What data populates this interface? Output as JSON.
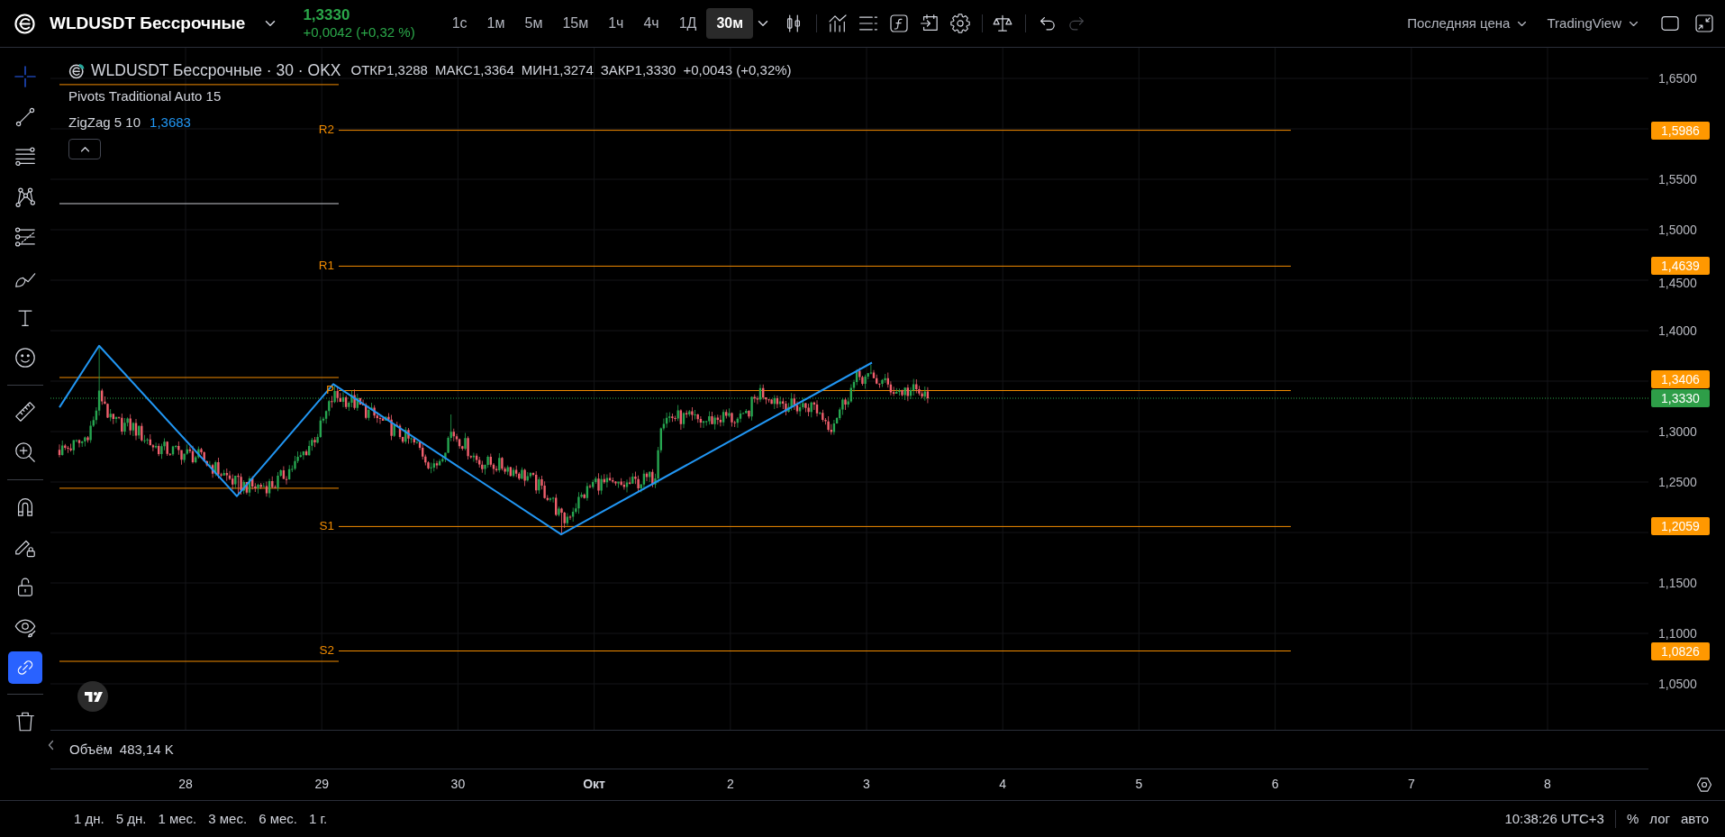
{
  "header": {
    "symbol": "WLDUSDT Бессрочные",
    "price": "1,3330",
    "change": "+0,0042 (+0,32 %)"
  },
  "intervals": [
    {
      "label": "1с",
      "selected": false
    },
    {
      "label": "1м",
      "selected": false
    },
    {
      "label": "5м",
      "selected": false
    },
    {
      "label": "15м",
      "selected": false
    },
    {
      "label": "1ч",
      "selected": false
    },
    {
      "label": "4ч",
      "selected": false
    },
    {
      "label": "1Д",
      "selected": false
    },
    {
      "label": "30м",
      "selected": true
    }
  ],
  "history": [
    {
      "disabled": false
    },
    {
      "disabled": true
    }
  ],
  "menus": {
    "price_source": "Последняя цена",
    "layout": "TradingView"
  },
  "tools": {
    "drawing": [
      {
        "selected": true
      },
      {
        "selected": false
      },
      {
        "selected": false
      },
      {
        "selected": false
      },
      {
        "selected": false
      },
      {
        "selected": false
      },
      {
        "selected": false
      },
      {
        "selected": false
      }
    ],
    "measure": [
      {
        "selected": false
      },
      {
        "selected": false
      }
    ],
    "toggles": [
      {
        "on": false
      },
      {
        "on": false
      },
      {
        "on": false
      },
      {
        "on": false
      },
      {
        "on": true
      }
    ]
  },
  "legend": {
    "title": "WLDUSDT Бессрочные · 30 · OKX",
    "ohlc": [
      {
        "label": "ОТКР",
        "value": "1,3288"
      },
      {
        "label": "МАКС",
        "value": "1,3364"
      },
      {
        "label": "МИН",
        "value": "1,3274"
      },
      {
        "label": "ЗАКР",
        "value": "1,3330"
      }
    ],
    "change": "+0,0043 (+0,32%)",
    "indicators": [
      {
        "name": "Pivots Traditional Auto 15"
      },
      {
        "name": "ZigZag 5 10",
        "value": "1,3683"
      }
    ]
  },
  "chart": {
    "pivot_levels": [
      {
        "label": "R2",
        "price_tag": "1,5986"
      },
      {
        "label": "R1",
        "price_tag": "1,4639"
      },
      {
        "label": "P",
        "price_tag": "1,3406"
      },
      {
        "label": "S1",
        "price_tag": "1,2059"
      },
      {
        "label": "S2",
        "price_tag": "1,0826"
      }
    ],
    "last_price_tag": "1,3330",
    "price_ticks": [
      "1,6500",
      "1,5500",
      "1,5000",
      "1,4500",
      "1,4000",
      "1,3000",
      "1,2500",
      "1,1500",
      "1,1000",
      "1,0500"
    ]
  },
  "volume": {
    "label": "Объём",
    "value": "483,14 K"
  },
  "time_ticks": [
    {
      "label": "28",
      "kind": "day"
    },
    {
      "label": "29",
      "kind": "day"
    },
    {
      "label": "30",
      "kind": "day"
    },
    {
      "label": "Окт",
      "kind": "month"
    },
    {
      "label": "2",
      "kind": "day"
    },
    {
      "label": "3",
      "kind": "day"
    },
    {
      "label": "4",
      "kind": "day"
    },
    {
      "label": "5",
      "kind": "day"
    },
    {
      "label": "6",
      "kind": "day"
    },
    {
      "label": "7",
      "kind": "day"
    },
    {
      "label": "8",
      "kind": "day"
    }
  ],
  "ranges": [
    "1 дн.",
    "5 дн.",
    "1 мес.",
    "3 мес.",
    "6 мес.",
    "1 г."
  ],
  "status_bar": {
    "clock": "10:38:26 UTC+3",
    "percent": "%",
    "log": "лог",
    "auto": "авто"
  }
}
